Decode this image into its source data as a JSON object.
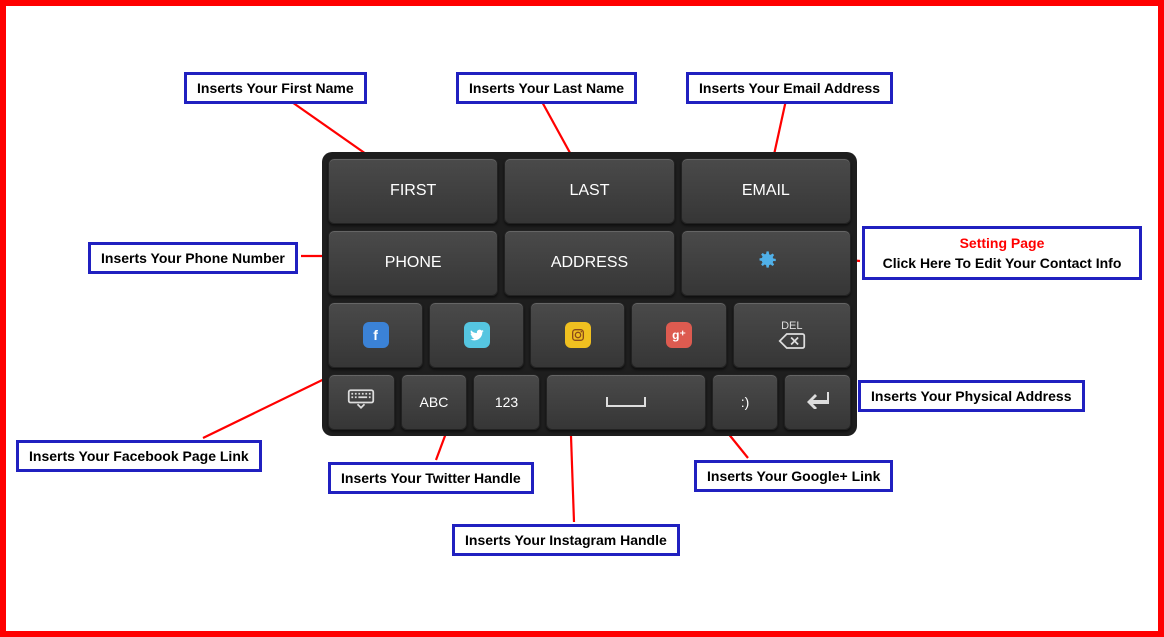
{
  "callouts": {
    "first_name": "Inserts Your First Name",
    "last_name": "Inserts Your Last Name",
    "email": "Inserts Your Email Address",
    "phone": "Inserts Your Phone Number",
    "setting_title": "Setting Page",
    "setting_body": "Click Here To Edit Your Contact Info",
    "address": "Inserts Your Physical Address",
    "facebook": "Inserts Your Facebook Page Link",
    "twitter": "Inserts Your Twitter Handle",
    "instagram": "Inserts Your Instagram Handle",
    "google": "Inserts Your Google+ Link"
  },
  "keys": {
    "row1": {
      "first": "FIRST",
      "last": "LAST",
      "email": "EMAIL"
    },
    "row2": {
      "phone": "PHONE",
      "address": "ADDRESS"
    },
    "row3": {
      "del_label": "DEL"
    },
    "row4": {
      "abc": "ABC",
      "num": "123",
      "smile": ":)"
    }
  },
  "icons": {
    "facebook": "f",
    "twitter": "♥",
    "instagram": "◉",
    "google": "g⁺"
  }
}
